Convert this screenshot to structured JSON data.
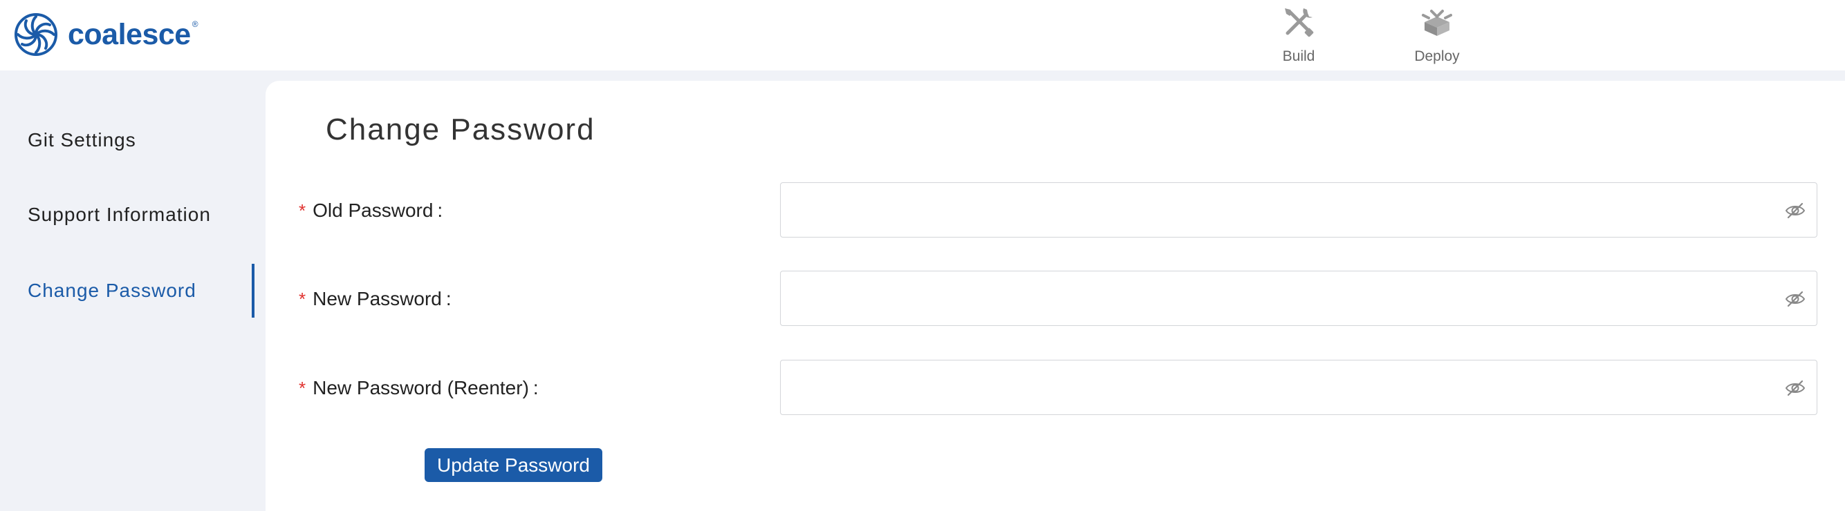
{
  "header": {
    "brand": "coalesce",
    "brand_mark": "®",
    "nav": [
      {
        "label": "Build",
        "icon": "tools-icon"
      },
      {
        "label": "Deploy",
        "icon": "deploy-icon"
      }
    ]
  },
  "sidebar": {
    "items": [
      {
        "label": "Git Settings",
        "active": false
      },
      {
        "label": "Support Information",
        "active": false
      },
      {
        "label": "Change Password",
        "active": true
      }
    ]
  },
  "main": {
    "title": "Change Password",
    "required_mark": "*",
    "colon": ":",
    "fields": [
      {
        "label": "Old Password",
        "value": ""
      },
      {
        "label": "New Password",
        "value": ""
      },
      {
        "label": "New Password (Reenter)",
        "value": ""
      }
    ],
    "submit_label": "Update Password"
  },
  "colors": {
    "accent": "#1b5ba8",
    "required": "#e0322f",
    "background": "#f0f2f7"
  }
}
